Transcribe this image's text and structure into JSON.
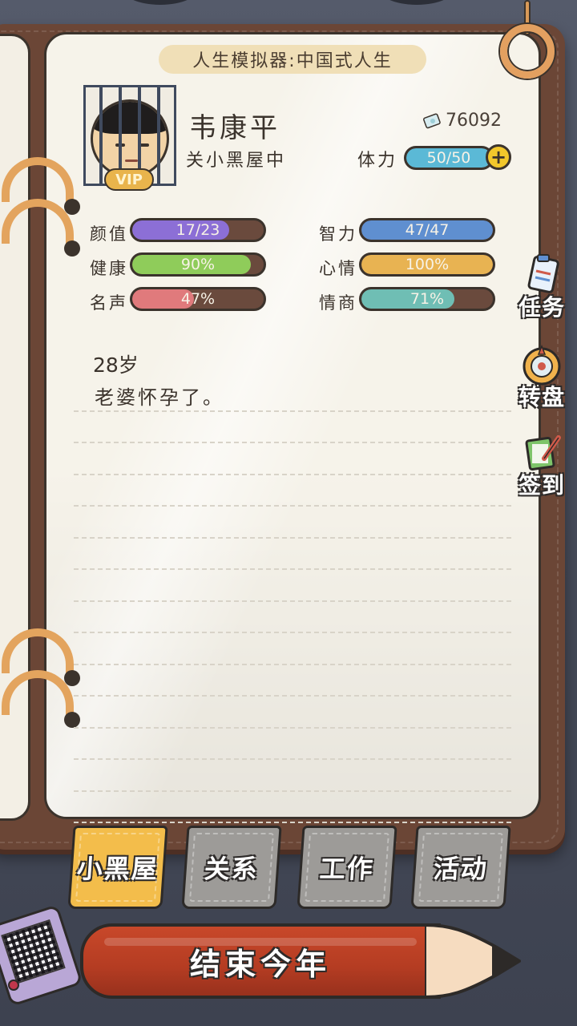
{
  "header": {
    "title": "人生模拟器:中国式人生"
  },
  "player": {
    "name": "韦康平",
    "status": "关小黑屋中",
    "vip_label": "VIP",
    "money": "76092",
    "stamina_label": "体力",
    "stamina_value": "50/50",
    "stamina_fraction": 1.0
  },
  "stats": [
    {
      "label": "颜值",
      "value": "17/23",
      "fraction": 0.74,
      "color": "#8c6fd6"
    },
    {
      "label": "智力",
      "value": "47/47",
      "fraction": 1.0,
      "color": "#5f8fd0"
    },
    {
      "label": "健康",
      "value": "90%",
      "fraction": 0.9,
      "color": "#8fcc5a"
    },
    {
      "label": "心情",
      "value": "100%",
      "fraction": 1.0,
      "color": "#e8b352"
    },
    {
      "label": "名声",
      "value": "47%",
      "fraction": 0.47,
      "color": "#e07a7c"
    },
    {
      "label": "情商",
      "value": "71%",
      "fraction": 0.71,
      "color": "#6fbeb4"
    }
  ],
  "log": {
    "age": "28岁",
    "event": "老婆怀孕了。"
  },
  "side_menu": [
    {
      "label": "任务",
      "icon": "clipboard-icon"
    },
    {
      "label": "转盘",
      "icon": "wheel-icon"
    },
    {
      "label": "签到",
      "icon": "checkin-icon"
    }
  ],
  "tabs": [
    {
      "label": "小黑屋",
      "active": true
    },
    {
      "label": "关系",
      "active": false
    },
    {
      "label": "工作",
      "active": false
    },
    {
      "label": "活动",
      "active": false
    }
  ],
  "actions": {
    "end_year": "结束今年"
  },
  "colors": {
    "cover": "#6b4636",
    "page": "#f6f3ea",
    "stamina": "#5bb9d6",
    "tab_active": "#f3bd4b",
    "tab_inactive": "#9d9b98",
    "pencil": "#c0432a"
  }
}
